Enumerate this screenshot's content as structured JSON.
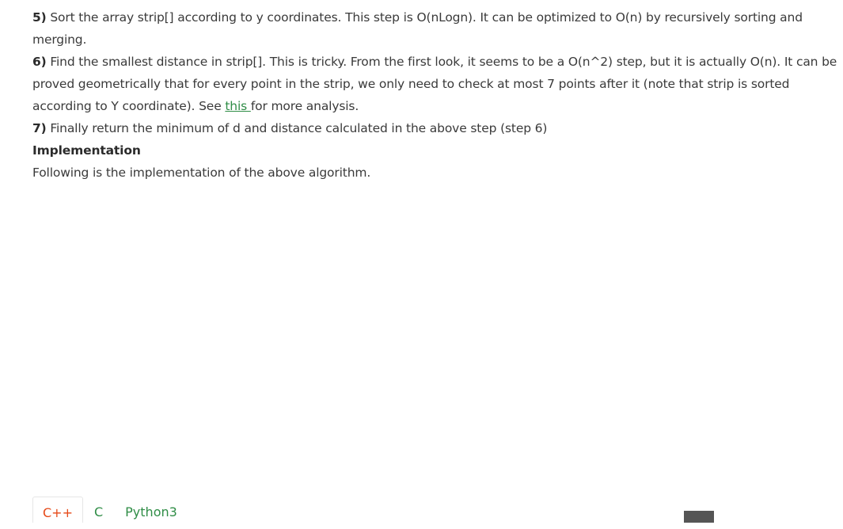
{
  "article": {
    "step5": {
      "num": "5)",
      "text": " Sort the array strip[] according to y coordinates. This step is O(nLogn). It can be optimized to O(n) by recursively sorting and merging."
    },
    "step6": {
      "num": "6)",
      "text_before": " Find the smallest distance in strip[]. This is tricky. From the first look, it seems to be a O(n^2) step, but it is actually O(n). It can be proved geometrically that for every point in the strip, we only need to check at most 7 points after it (note that strip is sorted according to Y coordinate). See ",
      "link": "this ",
      "text_after": "for more analysis."
    },
    "step7": {
      "num": "7)",
      "text": " Finally return the minimum of d and distance calculated in the above step (step 6)"
    },
    "implementation_heading": "Implementation",
    "implementation_text": "Following is the implementation of the above algorithm."
  },
  "tabs": [
    {
      "label": "C++",
      "active": true
    },
    {
      "label": "C",
      "active": false
    },
    {
      "label": "Python3",
      "active": false
    }
  ],
  "colors": {
    "text": "#3a3a3a",
    "link": "#2f8d46",
    "active_tab": "#e64a19",
    "inactive_tab": "#2f8d46"
  }
}
